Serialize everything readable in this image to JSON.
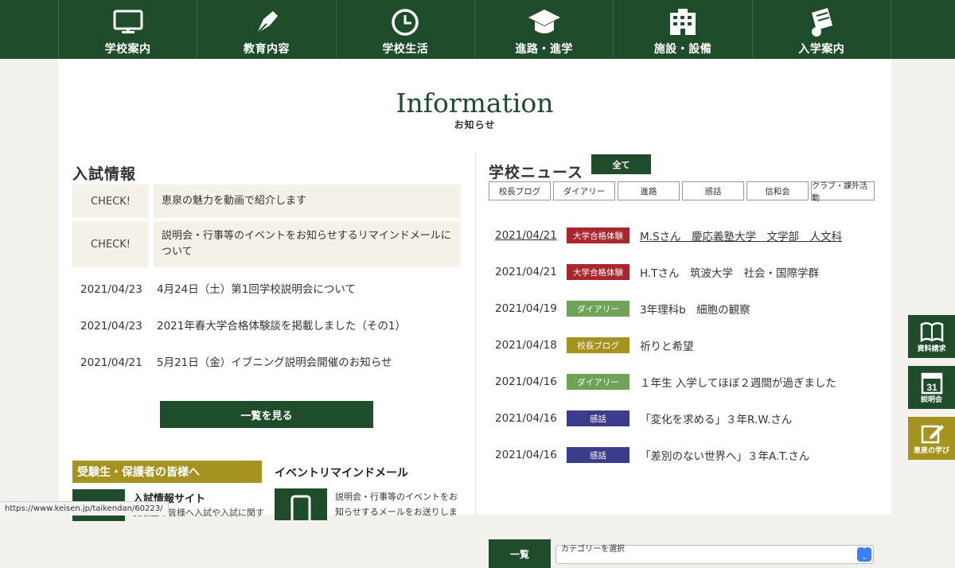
{
  "nav": [
    {
      "label": "学校案内",
      "icon": "monitor-icon"
    },
    {
      "label": "教育内容",
      "icon": "pen-nib-icon"
    },
    {
      "label": "学校生活",
      "icon": "clock-icon"
    },
    {
      "label": "進路・進学",
      "icon": "graduation-cap-icon"
    },
    {
      "label": "施設・設備",
      "icon": "building-icon"
    },
    {
      "label": "入学案内",
      "icon": "diploma-icon"
    }
  ],
  "info": {
    "title": "Information",
    "subtitle": "お知らせ"
  },
  "admissions": {
    "title": "入試情報",
    "checks": [
      {
        "tag": "CHECK!",
        "text": "恵泉の魅力を動画で紹介します"
      },
      {
        "tag": "CHECK!",
        "text": "説明会・行事等のイベントをお知らせするリマインドメールについて"
      }
    ],
    "news": [
      {
        "date": "2021/04/23",
        "text": "4月24日（土）第1回学校説明会について"
      },
      {
        "date": "2021/04/23",
        "text": "2021年春大学合格体験談を掲載しました（その1）"
      },
      {
        "date": "2021/04/21",
        "text": "5月21日（金）イブニング説明会開催のお知らせ"
      }
    ],
    "more_label": "一覧を見る"
  },
  "guardians": {
    "title": "受験生・保護者の皆様へ",
    "link": "入試情報サイト",
    "desc": "受験生の皆様へ入試や入試に関す"
  },
  "event": {
    "title": "イベントリマインドメール",
    "desc": "説明会・行事等のイベントをお知らせするメールをお送りしま"
  },
  "school_news": {
    "title": "学校ニュース",
    "all_label": "全て",
    "categories": [
      "校長ブログ",
      "ダイアリー",
      "進路",
      "感話",
      "信和会",
      "クラブ・課外活動"
    ],
    "items": [
      {
        "date": "2021/04/21",
        "badge": "大学合格体験",
        "color": "#a8262d",
        "text": "M.Sさん　慶応義塾大学　文学部　人文科"
      },
      {
        "date": "2021/04/21",
        "badge": "大学合格体験",
        "color": "#a8262d",
        "text": "H.Tさん　筑波大学　社会・国際学群"
      },
      {
        "date": "2021/04/19",
        "badge": "ダイアリー",
        "color": "#6fa35a",
        "text": "3年理科b　細胞の観察"
      },
      {
        "date": "2021/04/18",
        "badge": "校長ブログ",
        "color": "#a6921f",
        "text": "祈りと希望"
      },
      {
        "date": "2021/04/16",
        "badge": "ダイアリー",
        "color": "#6fa35a",
        "text": "１年生 入学してほぼ２週間が過ぎました"
      },
      {
        "date": "2021/04/16",
        "badge": "感話",
        "color": "#3c3c8c",
        "text": "「変化を求める」３年R.W.さん"
      },
      {
        "date": "2021/04/16",
        "badge": "感話",
        "color": "#3c3c8c",
        "text": "「差別のない世界へ」３年A.T.さん"
      }
    ],
    "list_label": "一覧",
    "select_placeholder": "カテゴリーを選択"
  },
  "side_buttons": [
    {
      "label": "資料請求",
      "icon": "book-icon",
      "color": "#1f4d2b"
    },
    {
      "label": "説明会",
      "icon": "calendar-icon",
      "color": "#1f4d2b",
      "day": "31"
    },
    {
      "label": "恵泉の学び",
      "icon": "edit-icon",
      "color": "#a6921f"
    }
  ],
  "status_url": "https://www.keisen.jp/taikendan/60223/"
}
